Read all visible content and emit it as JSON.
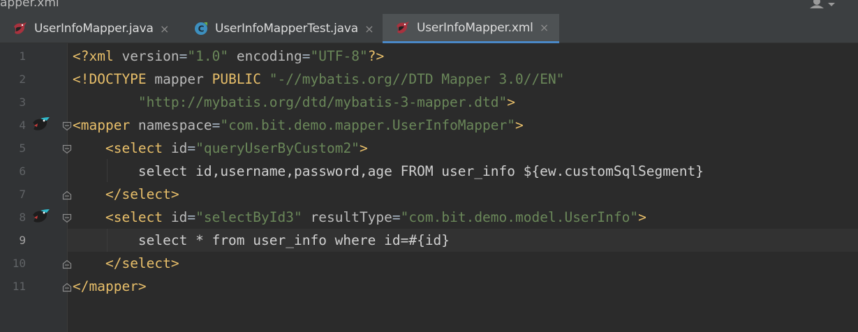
{
  "window": {
    "title_fragment": "apper.xml"
  },
  "tabs": [
    {
      "label": "UserInfoMapper.java",
      "close": "×",
      "active": false,
      "icon": "mybatis-bird-icon"
    },
    {
      "label": "UserInfoMapperTest.java",
      "close": "×",
      "active": false,
      "icon": "java-class-icon",
      "icon_letter": "C"
    },
    {
      "label": "UserInfoMapper.xml",
      "close": "×",
      "active": true,
      "icon": "mybatis-bird-icon"
    }
  ],
  "editor": {
    "current_line": 9,
    "lines": [
      {
        "number": "1",
        "gutter_icon": "",
        "fold": "",
        "tokens": [
          {
            "t": "tag",
            "v": "<?xml "
          },
          {
            "t": "attr",
            "v": "version"
          },
          {
            "t": "plain",
            "v": "="
          },
          {
            "t": "str",
            "v": "\"1.0\""
          },
          {
            "t": "plain",
            "v": " "
          },
          {
            "t": "attr",
            "v": "encoding"
          },
          {
            "t": "plain",
            "v": "="
          },
          {
            "t": "str",
            "v": "\"UTF-8\""
          },
          {
            "t": "tag",
            "v": "?>"
          }
        ]
      },
      {
        "number": "2",
        "gutter_icon": "",
        "fold": "",
        "tokens": [
          {
            "t": "tag",
            "v": "<!DOCTYPE "
          },
          {
            "t": "attr",
            "v": "mapper "
          },
          {
            "t": "tag",
            "v": "PUBLIC "
          },
          {
            "t": "str",
            "v": "\"-//mybatis.org//DTD Mapper 3.0//EN\""
          }
        ]
      },
      {
        "number": "3",
        "gutter_icon": "",
        "fold": "",
        "tokens": [
          {
            "t": "plain",
            "v": "        "
          },
          {
            "t": "str",
            "v": "\"http://mybatis.org/dtd/mybatis-3-mapper.dtd\""
          },
          {
            "t": "tag",
            "v": ">"
          }
        ]
      },
      {
        "number": "4",
        "gutter_icon": "mybatis-bird-icon",
        "fold": "open",
        "tokens": [
          {
            "t": "tag",
            "v": "<mapper "
          },
          {
            "t": "attr",
            "v": "namespace"
          },
          {
            "t": "plain",
            "v": "="
          },
          {
            "t": "str",
            "v": "\"com.bit.demo.mapper.UserInfoMapper\""
          },
          {
            "t": "tag",
            "v": ">"
          }
        ]
      },
      {
        "number": "5",
        "gutter_icon": "",
        "fold": "open",
        "tokens": [
          {
            "t": "plain",
            "v": "    "
          },
          {
            "t": "tag",
            "v": "<select "
          },
          {
            "t": "attr",
            "v": "id"
          },
          {
            "t": "plain",
            "v": "="
          },
          {
            "t": "str",
            "v": "\"queryUserByCustom2\""
          },
          {
            "t": "tag",
            "v": ">"
          }
        ]
      },
      {
        "number": "6",
        "gutter_icon": "",
        "fold": "",
        "tokens": [
          {
            "t": "plain",
            "v": "        "
          },
          {
            "t": "sql",
            "v": "select id,username,password,age FROM user_info ${ew.customSqlSegment}"
          }
        ]
      },
      {
        "number": "7",
        "gutter_icon": "",
        "fold": "close",
        "tokens": [
          {
            "t": "plain",
            "v": "    "
          },
          {
            "t": "tag",
            "v": "</select>"
          }
        ]
      },
      {
        "number": "8",
        "gutter_icon": "mybatis-bird-icon",
        "fold": "open",
        "tokens": [
          {
            "t": "plain",
            "v": "    "
          },
          {
            "t": "tag",
            "v": "<select "
          },
          {
            "t": "attr",
            "v": "id"
          },
          {
            "t": "plain",
            "v": "="
          },
          {
            "t": "str",
            "v": "\"selectById3\""
          },
          {
            "t": "plain",
            "v": " "
          },
          {
            "t": "attr",
            "v": "resultType"
          },
          {
            "t": "plain",
            "v": "="
          },
          {
            "t": "str",
            "v": "\"com.bit.demo.model.UserInfo\""
          },
          {
            "t": "tag",
            "v": ">"
          }
        ]
      },
      {
        "number": "9",
        "gutter_icon": "",
        "fold": "",
        "tokens": [
          {
            "t": "plain",
            "v": "        "
          },
          {
            "t": "sql",
            "v": "select * from user_info where id=#{id}"
          }
        ]
      },
      {
        "number": "10",
        "gutter_icon": "",
        "fold": "close",
        "tokens": [
          {
            "t": "plain",
            "v": "    "
          },
          {
            "t": "tag",
            "v": "</select>"
          }
        ]
      },
      {
        "number": "11",
        "gutter_icon": "",
        "fold": "close",
        "tokens": [
          {
            "t": "tag",
            "v": "</mapper>"
          }
        ]
      }
    ]
  },
  "colors": {
    "background": "#2b2b2b",
    "gutter": "#313335",
    "tab_bar": "#3c3f41",
    "active_tab": "#4e5254",
    "active_tab_underline": "#4a88c7",
    "current_line": "#323232",
    "xml_tag": "#e8bf6a",
    "xml_attribute": "#bababa",
    "xml_string": "#6a8759",
    "text": "#a9b7c6"
  }
}
